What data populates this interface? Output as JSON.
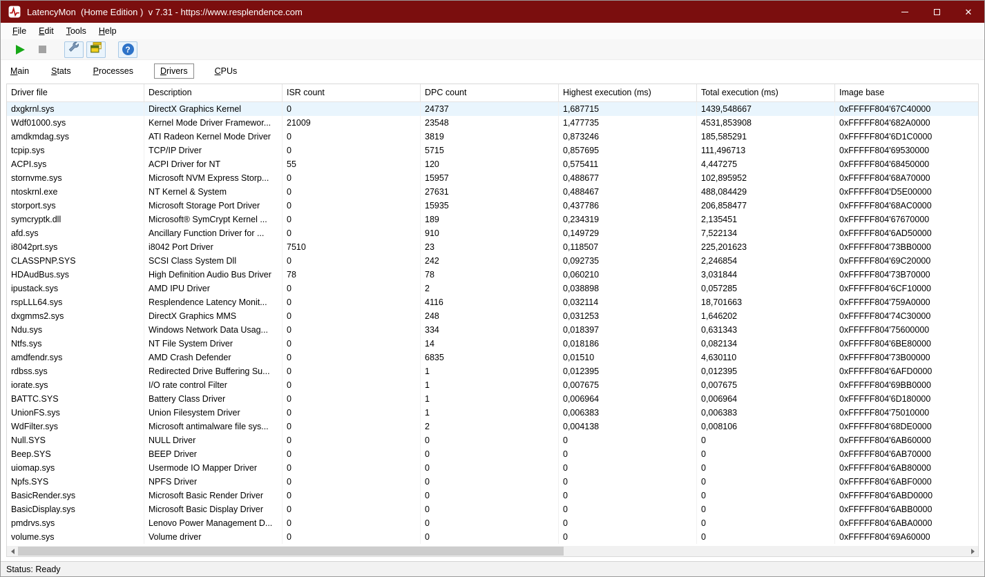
{
  "window": {
    "title": "LatencyMon  (Home Edition )  v 7.31 - https://www.resplendence.com"
  },
  "menu": {
    "items": [
      "File",
      "Edit",
      "Tools",
      "Help"
    ]
  },
  "toolbar": {
    "buttons": [
      "start-monitor",
      "stop-monitor",
      "tools",
      "window-views",
      "help"
    ]
  },
  "icons": {
    "help": "?"
  },
  "tabs": {
    "items": [
      "Main",
      "Stats",
      "Processes",
      "Drivers",
      "CPUs"
    ],
    "active": "Drivers"
  },
  "table": {
    "columns": [
      "Driver file",
      "Description",
      "ISR count",
      "DPC count",
      "Highest execution (ms)",
      "Total execution (ms)",
      "Image base"
    ],
    "highlighted_row": 0,
    "rows": [
      [
        "dxgkrnl.sys",
        "DirectX Graphics Kernel",
        "0",
        "24737",
        "1,687715",
        "1439,548667",
        "0xFFFFF804'67C40000"
      ],
      [
        "Wdf01000.sys",
        "Kernel Mode Driver Framewor...",
        "21009",
        "23548",
        "1,477735",
        "4531,853908",
        "0xFFFFF804'682A0000"
      ],
      [
        "amdkmdag.sys",
        "ATI Radeon Kernel Mode Driver",
        "0",
        "3819",
        "0,873246",
        "185,585291",
        "0xFFFFF804'6D1C0000"
      ],
      [
        "tcpip.sys",
        "TCP/IP Driver",
        "0",
        "5715",
        "0,857695",
        "111,496713",
        "0xFFFFF804'69530000"
      ],
      [
        "ACPI.sys",
        "ACPI Driver for NT",
        "55",
        "120",
        "0,575411",
        "4,447275",
        "0xFFFFF804'68450000"
      ],
      [
        "stornvme.sys",
        "Microsoft NVM Express Storp...",
        "0",
        "15957",
        "0,488677",
        "102,895952",
        "0xFFFFF804'68A70000"
      ],
      [
        "ntoskrnl.exe",
        "NT Kernel & System",
        "0",
        "27631",
        "0,488467",
        "488,084429",
        "0xFFFFF804'D5E00000"
      ],
      [
        "storport.sys",
        "Microsoft Storage Port Driver",
        "0",
        "15935",
        "0,437786",
        "206,858477",
        "0xFFFFF804'68AC0000"
      ],
      [
        "symcryptk.dll",
        "Microsoft® SymCrypt Kernel ...",
        "0",
        "189",
        "0,234319",
        "2,135451",
        "0xFFFFF804'67670000"
      ],
      [
        "afd.sys",
        "Ancillary Function Driver for ...",
        "0",
        "910",
        "0,149729",
        "7,522134",
        "0xFFFFF804'6AD50000"
      ],
      [
        "i8042prt.sys",
        "i8042 Port Driver",
        "7510",
        "23",
        "0,118507",
        "225,201623",
        "0xFFFFF804'73BB0000"
      ],
      [
        "CLASSPNP.SYS",
        "SCSI Class System Dll",
        "0",
        "242",
        "0,092735",
        "2,246854",
        "0xFFFFF804'69C20000"
      ],
      [
        "HDAudBus.sys",
        "High Definition Audio Bus Driver",
        "78",
        "78",
        "0,060210",
        "3,031844",
        "0xFFFFF804'73B70000"
      ],
      [
        "ipustack.sys",
        "AMD IPU Driver",
        "0",
        "2",
        "0,038898",
        "0,057285",
        "0xFFFFF804'6CF10000"
      ],
      [
        "rspLLL64.sys",
        "Resplendence Latency Monit...",
        "0",
        "4116",
        "0,032114",
        "18,701663",
        "0xFFFFF804'759A0000"
      ],
      [
        "dxgmms2.sys",
        "DirectX Graphics MMS",
        "0",
        "248",
        "0,031253",
        "1,646202",
        "0xFFFFF804'74C30000"
      ],
      [
        "Ndu.sys",
        "Windows Network Data Usag...",
        "0",
        "334",
        "0,018397",
        "0,631343",
        "0xFFFFF804'75600000"
      ],
      [
        "Ntfs.sys",
        "NT File System Driver",
        "0",
        "14",
        "0,018186",
        "0,082134",
        "0xFFFFF804'6BE80000"
      ],
      [
        "amdfendr.sys",
        "AMD Crash Defender",
        "0",
        "6835",
        "0,01510",
        "4,630110",
        "0xFFFFF804'73B00000"
      ],
      [
        "rdbss.sys",
        "Redirected Drive Buffering Su...",
        "0",
        "1",
        "0,012395",
        "0,012395",
        "0xFFFFF804'6AFD0000"
      ],
      [
        "iorate.sys",
        "I/O rate control Filter",
        "0",
        "1",
        "0,007675",
        "0,007675",
        "0xFFFFF804'69BB0000"
      ],
      [
        "BATTC.SYS",
        "Battery Class Driver",
        "0",
        "1",
        "0,006964",
        "0,006964",
        "0xFFFFF804'6D180000"
      ],
      [
        "UnionFS.sys",
        "Union Filesystem Driver",
        "0",
        "1",
        "0,006383",
        "0,006383",
        "0xFFFFF804'75010000"
      ],
      [
        "WdFilter.sys",
        "Microsoft antimalware file sys...",
        "0",
        "2",
        "0,004138",
        "0,008106",
        "0xFFFFF804'68DE0000"
      ],
      [
        "Null.SYS",
        "NULL Driver",
        "0",
        "0",
        "0",
        "0",
        "0xFFFFF804'6AB60000"
      ],
      [
        "Beep.SYS",
        "BEEP Driver",
        "0",
        "0",
        "0",
        "0",
        "0xFFFFF804'6AB70000"
      ],
      [
        "uiomap.sys",
        "Usermode IO Mapper Driver",
        "0",
        "0",
        "0",
        "0",
        "0xFFFFF804'6AB80000"
      ],
      [
        "Npfs.SYS",
        "NPFS Driver",
        "0",
        "0",
        "0",
        "0",
        "0xFFFFF804'6ABF0000"
      ],
      [
        "BasicRender.sys",
        "Microsoft Basic Render Driver",
        "0",
        "0",
        "0",
        "0",
        "0xFFFFF804'6ABD0000"
      ],
      [
        "BasicDisplay.sys",
        "Microsoft Basic Display Driver",
        "0",
        "0",
        "0",
        "0",
        "0xFFFFF804'6ABB0000"
      ],
      [
        "pmdrvs.sys",
        "Lenovo Power Management D...",
        "0",
        "0",
        "0",
        "0",
        "0xFFFFF804'6ABA0000"
      ],
      [
        "volume.sys",
        "Volume driver",
        "0",
        "0",
        "0",
        "0",
        "0xFFFFF804'69A60000"
      ]
    ]
  },
  "statusbar": {
    "text": "Status: Ready"
  },
  "colors": {
    "titlebar": "#7b0e0e",
    "row_highlight": "#e9f5fd",
    "play_green": "#17a817",
    "stop_gray": "#a2a2a2",
    "help_blue": "#2e73c8"
  }
}
